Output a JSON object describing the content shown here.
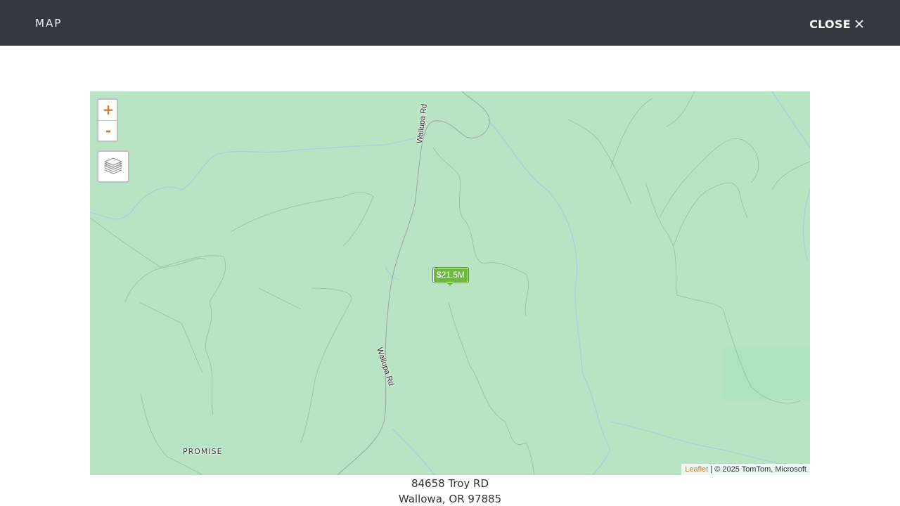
{
  "header": {
    "title": "MAP",
    "close_label": "CLOSE",
    "close_icon": "close-icon"
  },
  "map": {
    "zoom_in_label": "+",
    "zoom_out_label": "-",
    "layers_icon": "layers-icon",
    "marker_label": "$21.5M",
    "place_label": "PROMISE",
    "road_labels": [
      "Wallupa Rd",
      "Wallupa Rd"
    ],
    "attribution": {
      "leaflet": "Leaflet",
      "rest": " | © 2025 TomTom, Microsoft"
    },
    "colors": {
      "land": "#b9e4c3",
      "marker": "#6cba3f",
      "control_accent": "#d9782c"
    }
  },
  "address": {
    "line1": "84658  Troy RD",
    "line2": "Wallowa, OR 97885"
  }
}
